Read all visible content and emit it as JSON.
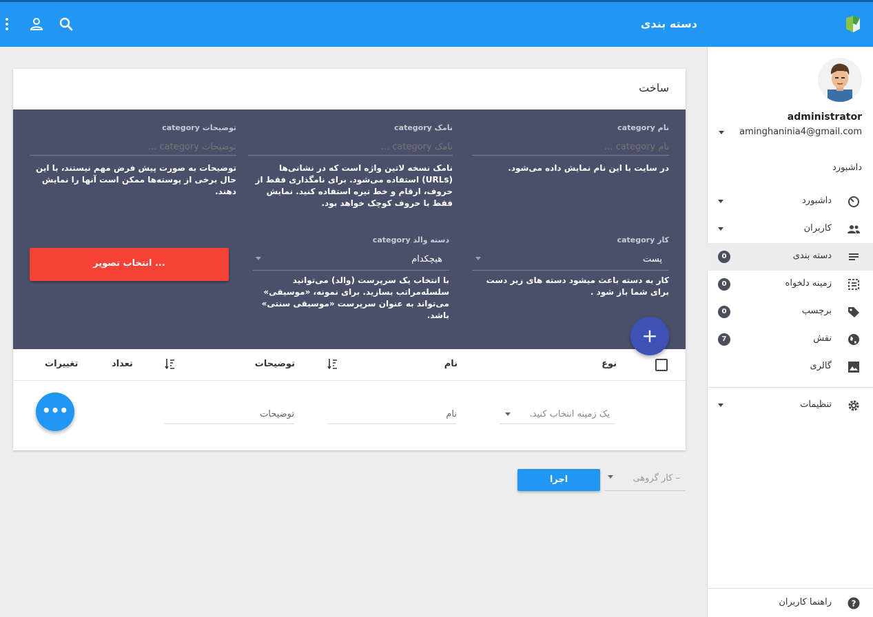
{
  "header": {
    "title": "دسته بندی"
  },
  "sidebar": {
    "user_name": "administrator",
    "user_email": "aminghaninia4@gmail.com",
    "section_title": "داشبورد",
    "items": [
      {
        "label": "داشبورد",
        "icon": "dashboard-icon"
      },
      {
        "label": "کاربران",
        "icon": "users-icon"
      },
      {
        "label": "دسته بندی",
        "icon": "category-icon",
        "badge": "0"
      },
      {
        "label": "زمینه دلخواه",
        "icon": "custom-field-icon",
        "badge": "0"
      },
      {
        "label": "برچسب",
        "icon": "tag-icon",
        "badge": "0"
      },
      {
        "label": "نقش",
        "icon": "role-icon",
        "badge": "7"
      },
      {
        "label": "گالری",
        "icon": "gallery-icon"
      }
    ],
    "settings_label": "تنظیمات",
    "help_label": "راهنما کاربران"
  },
  "form": {
    "card_title": "ساخت",
    "name_label": "نام category",
    "name_placeholder": "نام category ...",
    "name_help": "در سایت با این نام نمایش داده می‌شود.",
    "slug_label": "نامک category",
    "slug_placeholder": "نامک category ...",
    "slug_help": "نامک نسخه لاتین واژه است که در نشانی‌ها (URLs) استفاده می‌شود. برای نامگذاری فقط از حروف، ارقام و خط تیره استفاده کنید. نمایش فقط با حروف کوچک خواهد بود.",
    "desc_label": "توضیحات category",
    "desc_placeholder": "توضیحات category ...",
    "desc_help": "توضیحات به صورت پیش فرض مهم نیستند، با این حال برخی از پوسته‌ها ممکن است آنها را نمایش دهند.",
    "type_label": "کار category",
    "type_value": "پست",
    "type_help": "کار به دسته باعث میشود دسته های زیر دست برای شما باز شود .",
    "parent_label": "دسته والد category",
    "parent_value": "هیچکدام",
    "parent_help": "با انتخاب یک سرپرست (والد) می‌توانید سلسله‌مراتب بسازید. برای نمونه، «موسیقی» می‌تواند به عنوان سرپرست «موسیقی سنتی» باشد.",
    "image_button": "انتخاب تصویر ...",
    "add_button": "+"
  },
  "table": {
    "columns": [
      "نوع",
      "نام",
      "توضیحات",
      "تعداد",
      "تغییرات"
    ],
    "filter_type_placeholder": "یک زمینه انتخاب کنید.",
    "filter_name_placeholder": "نام",
    "filter_desc_placeholder": "توضیحات",
    "more_button": "•••"
  },
  "bulk": {
    "select_placeholder": "– کار گروهی",
    "run_button": "اجرا"
  },
  "colors": {
    "primary": "#2196f3",
    "form_bg": "#4a5069",
    "danger": "#f44336",
    "fab": "#3f51b5"
  }
}
